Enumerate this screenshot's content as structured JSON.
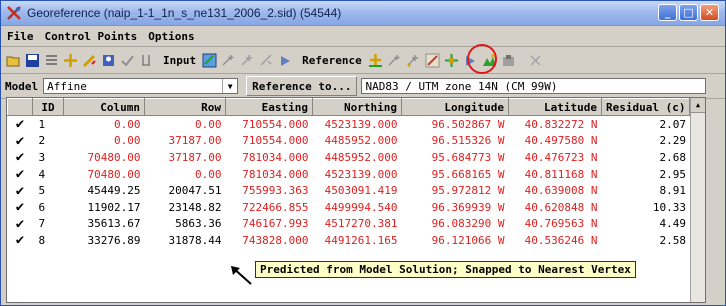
{
  "window": {
    "title": "Georeference (naip_1-1_1n_s_ne131_2006_2.sid) (54544)",
    "buttons": {
      "minimize": "_",
      "maximize": "□",
      "close": "✕"
    }
  },
  "menu": [
    "File",
    "Control Points",
    "Options"
  ],
  "toolbar": {
    "input_label": "Input",
    "reference_label": "Reference",
    "icons_left": [
      "open-icon",
      "save-icon",
      "list-icon",
      "add-point-icon",
      "edit-point-icon",
      "delete-point-icon",
      "check-icon",
      "residual-icon"
    ],
    "icons_input": [
      "input-view-icon",
      "input-zoom-icon",
      "input-snap-icon",
      "input-predict-icon",
      "input-vertex-icon"
    ],
    "icons_reference": [
      "ref-view-icon",
      "ref-zoom-icon",
      "ref-snap-icon",
      "ref-predict-snap-icon",
      "ref-vertex-icon",
      "ref-layer-icon",
      "ref-add-icon"
    ],
    "close_icon": "✕",
    "highlighted_icon": "ref-predict-snap-icon"
  },
  "model": {
    "label": "Model",
    "value": "Affine",
    "reference_button": "Reference to...",
    "reference_value": "NAD83 / UTM zone 14N (CM 99W)"
  },
  "table": {
    "headers": [
      "",
      "ID",
      "Column",
      "Row",
      "Easting",
      "Northing",
      "Longitude",
      "Latitude",
      "Residual (c)"
    ],
    "rows": [
      {
        "checked": "✔",
        "id": "1",
        "column": "0.00",
        "row": "0.00",
        "easting": "710554.000",
        "northing": "4523139.000",
        "longitude": "96.502867 W",
        "latitude": "40.832272 N",
        "residual": "2.07",
        "red_col": true,
        "red_row": true,
        "red_en": true,
        "red_ll": true
      },
      {
        "checked": "✔",
        "id": "2",
        "column": "0.00",
        "row": "37187.00",
        "easting": "710554.000",
        "northing": "4485952.000",
        "longitude": "96.515326 W",
        "latitude": "40.497580 N",
        "residual": "2.29",
        "red_col": true,
        "red_row": true,
        "red_en": true,
        "red_ll": true
      },
      {
        "checked": "✔",
        "id": "3",
        "column": "70480.00",
        "row": "37187.00",
        "easting": "781034.000",
        "northing": "4485952.000",
        "longitude": "95.684773 W",
        "latitude": "40.476723 N",
        "residual": "2.68",
        "red_col": true,
        "red_row": true,
        "red_en": true,
        "red_ll": true
      },
      {
        "checked": "✔",
        "id": "4",
        "column": "70480.00",
        "row": "0.00",
        "easting": "781034.000",
        "northing": "4523139.000",
        "longitude": "95.668165 W",
        "latitude": "40.811168 N",
        "residual": "2.95",
        "red_col": true,
        "red_row": true,
        "red_en": true,
        "red_ll": true
      },
      {
        "checked": "✔",
        "id": "5",
        "column": "45449.25",
        "row": "20047.51",
        "easting": "755993.363",
        "northing": "4503091.419",
        "longitude": "95.972812 W",
        "latitude": "40.639008 N",
        "residual": "8.91",
        "red_col": false,
        "red_row": false,
        "red_en": true,
        "red_ll": true
      },
      {
        "checked": "✔",
        "id": "6",
        "column": "11902.17",
        "row": "23148.82",
        "easting": "722466.855",
        "northing": "4499994.540",
        "longitude": "96.369939 W",
        "latitude": "40.620848 N",
        "residual": "10.33",
        "red_col": false,
        "red_row": false,
        "red_en": true,
        "red_ll": true
      },
      {
        "checked": "✔",
        "id": "7",
        "column": "35613.67",
        "row": "5863.36",
        "easting": "746167.993",
        "northing": "4517270.381",
        "longitude": "96.083290 W",
        "latitude": "40.769563 N",
        "residual": "4.49",
        "red_col": false,
        "red_row": false,
        "red_en": true,
        "red_ll": true
      },
      {
        "checked": "✔",
        "id": "8",
        "column": "33276.89",
        "row": "31878.44",
        "easting": "743828.000",
        "northing": "4491261.165",
        "longitude": "96.121066 W",
        "latitude": "40.536246 N",
        "residual": "2.58",
        "red_col": false,
        "red_row": false,
        "red_en": true,
        "red_ll": true
      }
    ]
  },
  "tooltip": "Predicted from Model Solution; Snapped to Nearest Vertex",
  "colors": {
    "red_text": "#e02020",
    "highlight_circle": "#e01818",
    "tooltip_bg": "#ffffc8"
  }
}
